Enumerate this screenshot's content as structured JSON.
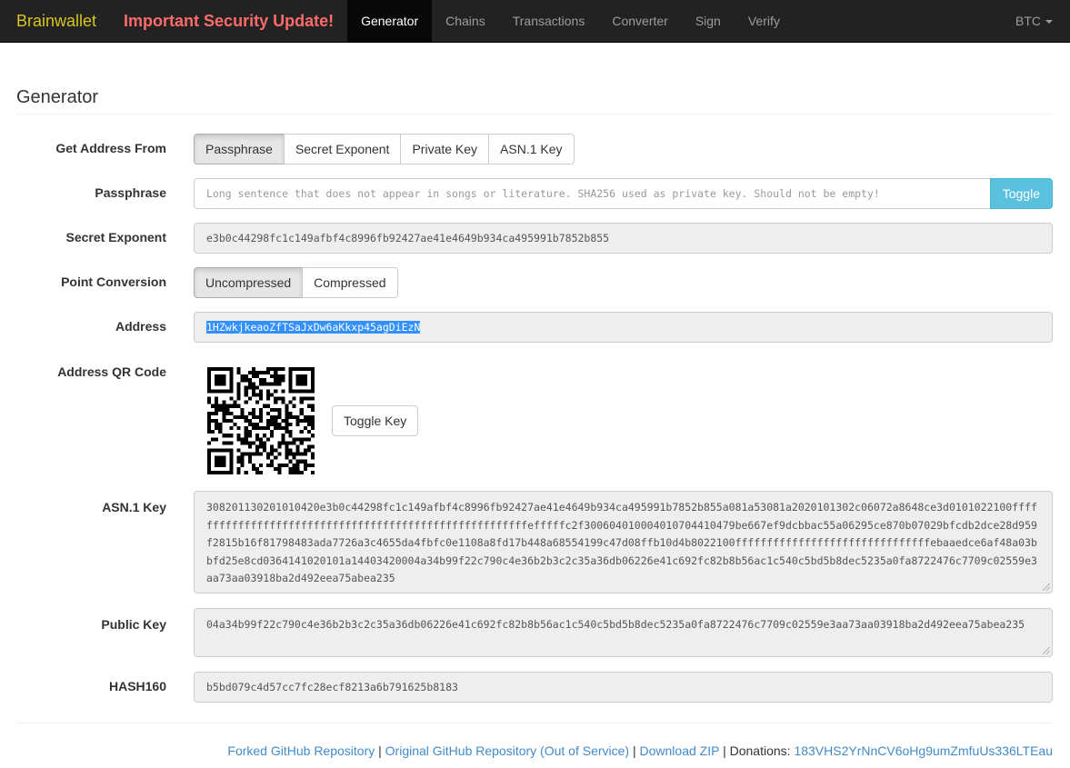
{
  "navbar": {
    "brand": "Brainwallet",
    "security_link": "Important Security Update!",
    "items": [
      {
        "label": "Generator",
        "active": true
      },
      {
        "label": "Chains"
      },
      {
        "label": "Transactions"
      },
      {
        "label": "Converter"
      },
      {
        "label": "Sign"
      },
      {
        "label": "Verify"
      }
    ],
    "coin": "BTC"
  },
  "page": {
    "title": "Generator"
  },
  "form": {
    "get_address_from": {
      "label": "Get Address From",
      "options": [
        "Passphrase",
        "Secret Exponent",
        "Private Key",
        "ASN.1 Key"
      ],
      "selected": "Passphrase"
    },
    "passphrase": {
      "label": "Passphrase",
      "placeholder": "Long sentence that does not appear in songs or literature. SHA256 used as private key. Should not be empty!",
      "toggle_label": "Toggle"
    },
    "secret_exponent": {
      "label": "Secret Exponent",
      "value": "e3b0c44298fc1c149afbf4c8996fb92427ae41e4649b934ca495991b7852b855"
    },
    "point_conversion": {
      "label": "Point Conversion",
      "options": [
        "Uncompressed",
        "Compressed"
      ],
      "selected": "Uncompressed"
    },
    "address": {
      "label": "Address",
      "value": "1HZwkjkeaoZfTSaJxDw6aKkxp45agDiEzN"
    },
    "address_qr": {
      "label": "Address QR Code",
      "toggle_key_label": "Toggle Key"
    },
    "asn1_key": {
      "label": "ASN.1 Key",
      "value": "308201130201010420e3b0c44298fc1c149afbf4c8996fb92427ae41e4649b934ca495991b7852b855a081a53081a2020101302c06072a8648ce3d0101022100fffffffffffffffffffffffffffffffffffffffffffffffffffffffefffffc2f300604010004010704410479be667ef9dcbbac55a06295ce870b07029bfcdb2dce28d959f2815b16f81798483ada7726a3c4655da4fbfc0e1108a8fd17b448a68554199c47d08ffb10d4b8022100fffffffffffffffffffffffffffffffebaaedce6af48a03bbfd25e8cd0364141020101a14403420004a34b99f22c790c4e36b2b3c2c35a36db06226e41c692fc82b8b56ac1c540c5bd5b8dec5235a0fa8722476c7709c02559e3aa73aa03918ba2d492eea75abea235"
    },
    "public_key": {
      "label": "Public Key",
      "value": "04a34b99f22c790c4e36b2b3c2c35a36db06226e41c692fc82b8b56ac1c540c5bd5b8dec5235a0fa8722476c7709c02559e3aa73aa03918ba2d492eea75abea235"
    },
    "hash160": {
      "label": "HASH160",
      "value": "b5bd079c4d57cc7fc28ecf8213a6b791625b8183"
    }
  },
  "footer": {
    "forked_repo": "Forked GitHub Repository",
    "original_repo": "Original GitHub Repository (Out of Service)",
    "download_zip": "Download ZIP",
    "sep": "|",
    "donations_label": "Donations:",
    "donation_address": "183VHS2YrNnCV6oHg9umZmfuUs336LTEau"
  }
}
